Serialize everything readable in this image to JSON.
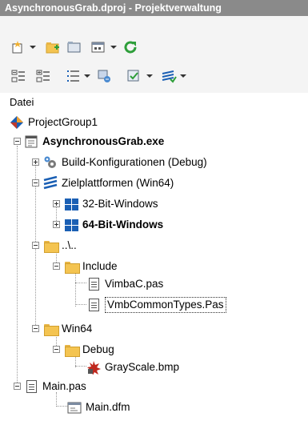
{
  "window": {
    "title": "AsynchronousGrab.dproj - Projektverwaltung"
  },
  "toolbar1": {
    "icons": [
      "new-item-icon",
      "add-folder-icon",
      "open-folder-icon",
      "view-options-icon",
      "refresh-icon"
    ],
    "colors": {
      "refresh": "#2e9e3a",
      "add_folder": "#f0a030"
    }
  },
  "toolbar2": {
    "icons": [
      "collapse-icon",
      "expand-icon",
      "list-icon",
      "build-icon",
      "check-icon",
      "build-config-icon"
    ]
  },
  "tree": {
    "header": "Datei",
    "nodes": {
      "group": "ProjectGroup1",
      "project": "AsynchronousGrab.exe",
      "build_config": "Build-Konfigurationen (Debug)",
      "platforms": "Zielplattformen (Win64)",
      "win32": "32-Bit-Windows",
      "win64": "64-Bit-Windows",
      "parent_dir": "..\\..",
      "include": "Include",
      "vimbac": "VimbaC.pas",
      "vmbcommon": "VmbCommonTypes.Pas",
      "win64_dir": "Win64",
      "debug": "Debug",
      "grayscale": "GrayScale.bmp",
      "main_pas": "Main.pas",
      "main_dfm": "Main.dfm"
    }
  }
}
